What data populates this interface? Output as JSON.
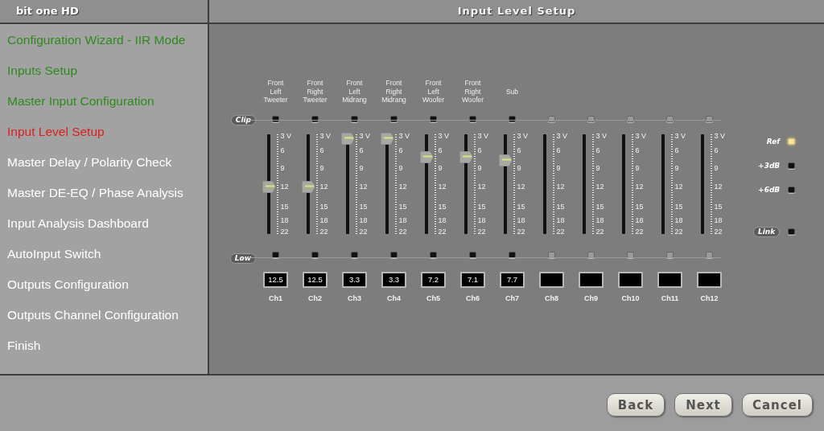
{
  "header": {
    "brand": "bit one HD",
    "title": "Input Level Setup"
  },
  "nav": [
    {
      "label": "Configuration Wizard - IIR Mode",
      "completed": true,
      "selected": false
    },
    {
      "label": "Inputs Setup",
      "completed": true,
      "selected": false
    },
    {
      "label": "Master Input Configuration",
      "completed": true,
      "selected": false
    },
    {
      "label": "Input Level Setup",
      "completed": false,
      "selected": true
    },
    {
      "label": "Master Delay / Polarity Check",
      "completed": false,
      "selected": false
    },
    {
      "label": "Master DE-EQ / Phase Analysis",
      "completed": false,
      "selected": false
    },
    {
      "label": "Input Analysis Dashboard",
      "completed": false,
      "selected": false
    },
    {
      "label": "AutoInput Switch",
      "completed": false,
      "selected": false
    },
    {
      "label": "Outputs Configuration",
      "completed": false,
      "selected": false
    },
    {
      "label": "Outputs Channel Configuration",
      "completed": false,
      "selected": false
    },
    {
      "label": "Finish",
      "completed": false,
      "selected": false
    }
  ],
  "row_labels": {
    "clip": "Clip",
    "low": "Low"
  },
  "channels": [
    {
      "name": "Ch1",
      "label": "Front Left Tweeter",
      "enabled": true,
      "level": 0.48,
      "reading": "12.5",
      "scale": [
        "3 V",
        "6",
        "9",
        "12",
        "15",
        "18",
        "22"
      ]
    },
    {
      "name": "Ch2",
      "label": "Front Right Tweeter",
      "enabled": true,
      "level": 0.48,
      "reading": "12.5",
      "scale": [
        "3 V",
        "6",
        "9",
        "12",
        "15",
        "18",
        "22"
      ]
    },
    {
      "name": "Ch3",
      "label": "Front Left Midrang",
      "enabled": true,
      "level": 1,
      "reading": "3.3",
      "scale": [
        "3 V",
        "6",
        "9",
        "12",
        "15",
        "18",
        "22"
      ]
    },
    {
      "name": "Ch4",
      "label": "Front Right Midrang",
      "enabled": true,
      "level": 1,
      "reading": "3.3",
      "scale": [
        "3 V",
        "6",
        "9",
        "12",
        "15",
        "18",
        "22"
      ]
    },
    {
      "name": "Ch5",
      "label": "Front Left Woofer",
      "enabled": true,
      "level": 0.8,
      "reading": "7.2",
      "scale": [
        "3 V",
        "6",
        "9",
        "12",
        "15",
        "18",
        "22"
      ]
    },
    {
      "name": "Ch6",
      "label": "Front Right Woofer",
      "enabled": true,
      "level": 0.8,
      "reading": "7.1",
      "scale": [
        "3 V",
        "6",
        "9",
        "12",
        "15",
        "18",
        "22"
      ]
    },
    {
      "name": "Ch7",
      "label": "Sub",
      "enabled": true,
      "level": 0.77,
      "reading": "7.7",
      "scale": [
        "3 V",
        "6",
        "9",
        "12",
        "15",
        "18",
        "22"
      ]
    },
    {
      "name": "Ch8",
      "enabled": false,
      "scale": [
        "3 V",
        "6",
        "9",
        "12",
        "15",
        "18",
        "22"
      ]
    },
    {
      "name": "Ch9",
      "enabled": false,
      "scale": [
        "3 V",
        "6",
        "9",
        "12",
        "15",
        "18",
        "22"
      ]
    },
    {
      "name": "Ch10",
      "enabled": false,
      "scale": [
        "3 V",
        "6",
        "9",
        "12",
        "15",
        "18",
        "22"
      ]
    },
    {
      "name": "Ch11",
      "enabled": false,
      "scale": [
        "3 V",
        "6",
        "9",
        "12",
        "15",
        "18",
        "22"
      ]
    },
    {
      "name": "Ch12",
      "enabled": false,
      "scale": [
        "3 V",
        "6",
        "9",
        "12",
        "15",
        "18",
        "22"
      ]
    }
  ],
  "references": [
    {
      "label": "Ref",
      "on": true
    },
    {
      "label": "+3dB",
      "on": false
    },
    {
      "label": "+6dB",
      "on": false
    }
  ],
  "link": {
    "label": "Link",
    "on": false
  },
  "buttons": [
    "Back",
    "Next",
    "Cancel"
  ]
}
